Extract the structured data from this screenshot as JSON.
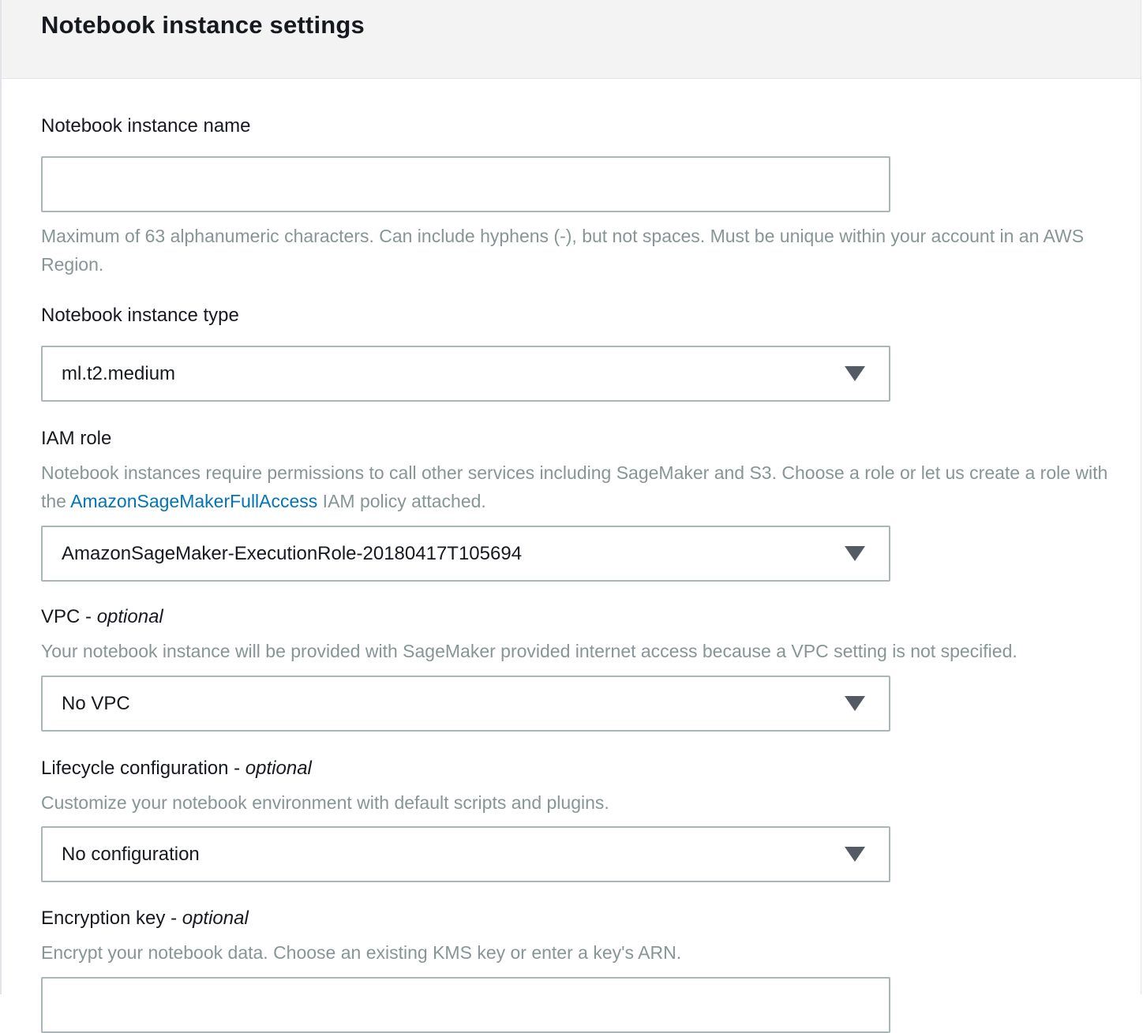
{
  "panel": {
    "title": "Notebook instance settings"
  },
  "fields": {
    "instance_name": {
      "label": "Notebook instance name",
      "value": "",
      "placeholder": "",
      "hint": "Maximum of 63 alphanumeric characters. Can include hyphens (-), but not spaces. Must be unique within your account in an AWS Region."
    },
    "instance_type": {
      "label": "Notebook instance type",
      "value": "ml.t2.medium"
    },
    "iam_role": {
      "label": "IAM role",
      "hint_before": "Notebook instances require permissions to call other services including SageMaker and S3. Choose a role or let us create a role with the ",
      "hint_link": "AmazonSageMakerFullAccess",
      "hint_after": " IAM policy attached.",
      "value": "AmazonSageMaker-ExecutionRole-20180417T105694"
    },
    "vpc": {
      "label": "VPC - ",
      "optional": "optional",
      "hint": "Your notebook instance will be provided with SageMaker provided internet access because a VPC setting is not specified.",
      "value": "No VPC"
    },
    "lifecycle": {
      "label": "Lifecycle configuration - ",
      "optional": "optional",
      "hint": "Customize your notebook environment with default scripts and plugins.",
      "value": "No configuration"
    },
    "encryption": {
      "label": "Encryption key - ",
      "optional": "optional",
      "hint": "Encrypt your notebook data. Choose an existing KMS key or enter a key's ARN."
    }
  },
  "icons": {
    "dropdown": "caret-down-icon"
  },
  "colors": {
    "header_bg": "#f3f3f3",
    "hint_text": "#879596",
    "link": "#0073bb",
    "input_border": "#aab7b8",
    "caret": "#545b64"
  }
}
